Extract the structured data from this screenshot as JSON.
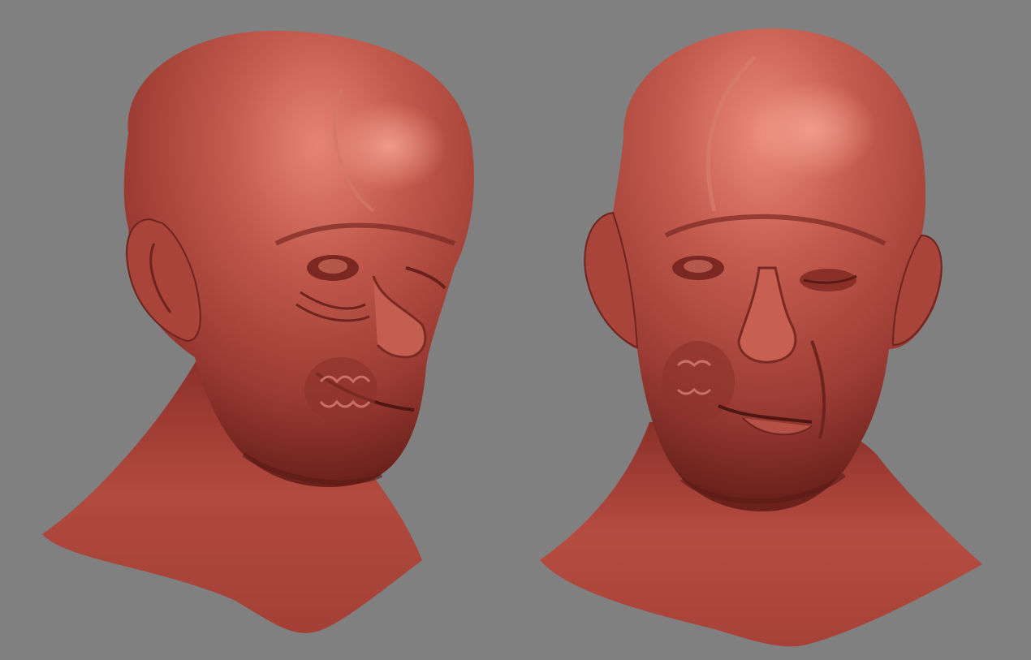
{
  "scene": {
    "background_color": "#808080",
    "material_color": "#b4483e",
    "highlight_color": "#e07b6e",
    "shadow_color": "#5a1a16",
    "views": [
      {
        "id": "three-quarter-right",
        "description_icon": "sculpted-head-bust"
      },
      {
        "id": "three-quarter-left",
        "description_icon": "sculpted-head-bust"
      }
    ]
  }
}
